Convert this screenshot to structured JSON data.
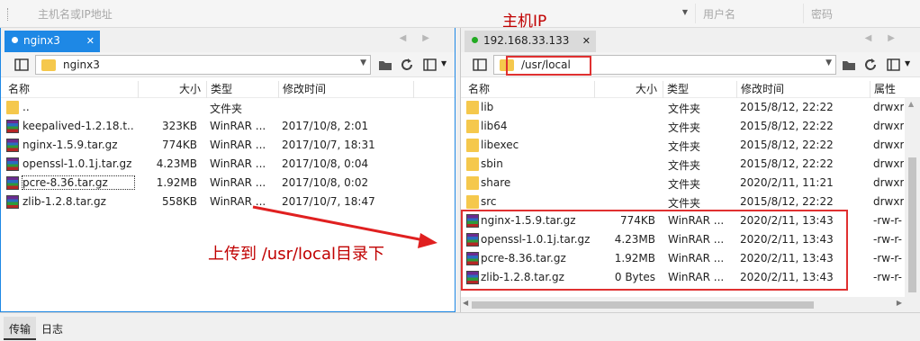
{
  "topbar": {
    "host_placeholder": "主机名或IP地址",
    "user_placeholder": "用户名",
    "password_placeholder": "密码"
  },
  "annotations": {
    "host_ip": "主机IP",
    "upload_note": "上传到 /usr/local目录下"
  },
  "left": {
    "tab_label": "nginx3",
    "path": "nginx3",
    "columns": {
      "name": "名称",
      "size": "大小",
      "type": "类型",
      "modified": "修改时间"
    },
    "rows": [
      {
        "icon": "folder",
        "name": "..",
        "size": "",
        "type": "文件夹",
        "modified": ""
      },
      {
        "icon": "rar",
        "name": "keepalived-1.2.18.t...",
        "size": "323KB",
        "type": "WinRAR ...",
        "modified": "2017/10/8, 2:01"
      },
      {
        "icon": "rar",
        "name": "nginx-1.5.9.tar.gz",
        "size": "774KB",
        "type": "WinRAR ...",
        "modified": "2017/10/7, 18:31"
      },
      {
        "icon": "rar",
        "name": "openssl-1.0.1j.tar.gz",
        "size": "4.23MB",
        "type": "WinRAR ...",
        "modified": "2017/10/8, 0:04"
      },
      {
        "icon": "rar",
        "name": "pcre-8.36.tar.gz",
        "size": "1.92MB",
        "type": "WinRAR ...",
        "modified": "2017/10/8, 0:02"
      },
      {
        "icon": "rar",
        "name": "zlib-1.2.8.tar.gz",
        "size": "558KB",
        "type": "WinRAR ...",
        "modified": "2017/10/7, 18:47"
      }
    ]
  },
  "right": {
    "tab_label": "192.168.33.133",
    "path": "/usr/local",
    "columns": {
      "name": "名称",
      "size": "大小",
      "type": "类型",
      "modified": "修改时间",
      "attr": "属性"
    },
    "rows": [
      {
        "icon": "folder",
        "name": "lib",
        "size": "",
        "type": "文件夹",
        "modified": "2015/8/12, 22:22",
        "attr": "drwxr"
      },
      {
        "icon": "folder",
        "name": "lib64",
        "size": "",
        "type": "文件夹",
        "modified": "2015/8/12, 22:22",
        "attr": "drwxr"
      },
      {
        "icon": "folder",
        "name": "libexec",
        "size": "",
        "type": "文件夹",
        "modified": "2015/8/12, 22:22",
        "attr": "drwxr"
      },
      {
        "icon": "folder",
        "name": "sbin",
        "size": "",
        "type": "文件夹",
        "modified": "2015/8/12, 22:22",
        "attr": "drwxr"
      },
      {
        "icon": "folder",
        "name": "share",
        "size": "",
        "type": "文件夹",
        "modified": "2020/2/11, 11:21",
        "attr": "drwxr"
      },
      {
        "icon": "folder",
        "name": "src",
        "size": "",
        "type": "文件夹",
        "modified": "2015/8/12, 22:22",
        "attr": "drwxr"
      },
      {
        "icon": "rar",
        "name": "nginx-1.5.9.tar.gz",
        "size": "774KB",
        "type": "WinRAR ...",
        "modified": "2020/2/11, 13:43",
        "attr": "-rw-r-"
      },
      {
        "icon": "rar",
        "name": "openssl-1.0.1j.tar.gz",
        "size": "4.23MB",
        "type": "WinRAR ...",
        "modified": "2020/2/11, 13:43",
        "attr": "-rw-r-"
      },
      {
        "icon": "rar",
        "name": "pcre-8.36.tar.gz",
        "size": "1.92MB",
        "type": "WinRAR ...",
        "modified": "2020/2/11, 13:43",
        "attr": "-rw-r-"
      },
      {
        "icon": "rar",
        "name": "zlib-1.2.8.tar.gz",
        "size": "0 Bytes",
        "type": "WinRAR ...",
        "modified": "2020/2/11, 13:43",
        "attr": "-rw-r-"
      }
    ]
  },
  "bottom": {
    "transfer_tab": "传输",
    "log_tab": "日志"
  },
  "colors": {
    "accent": "#1e88e5",
    "annotation_red": "#c00000",
    "connected_dot": "#22aa22"
  }
}
